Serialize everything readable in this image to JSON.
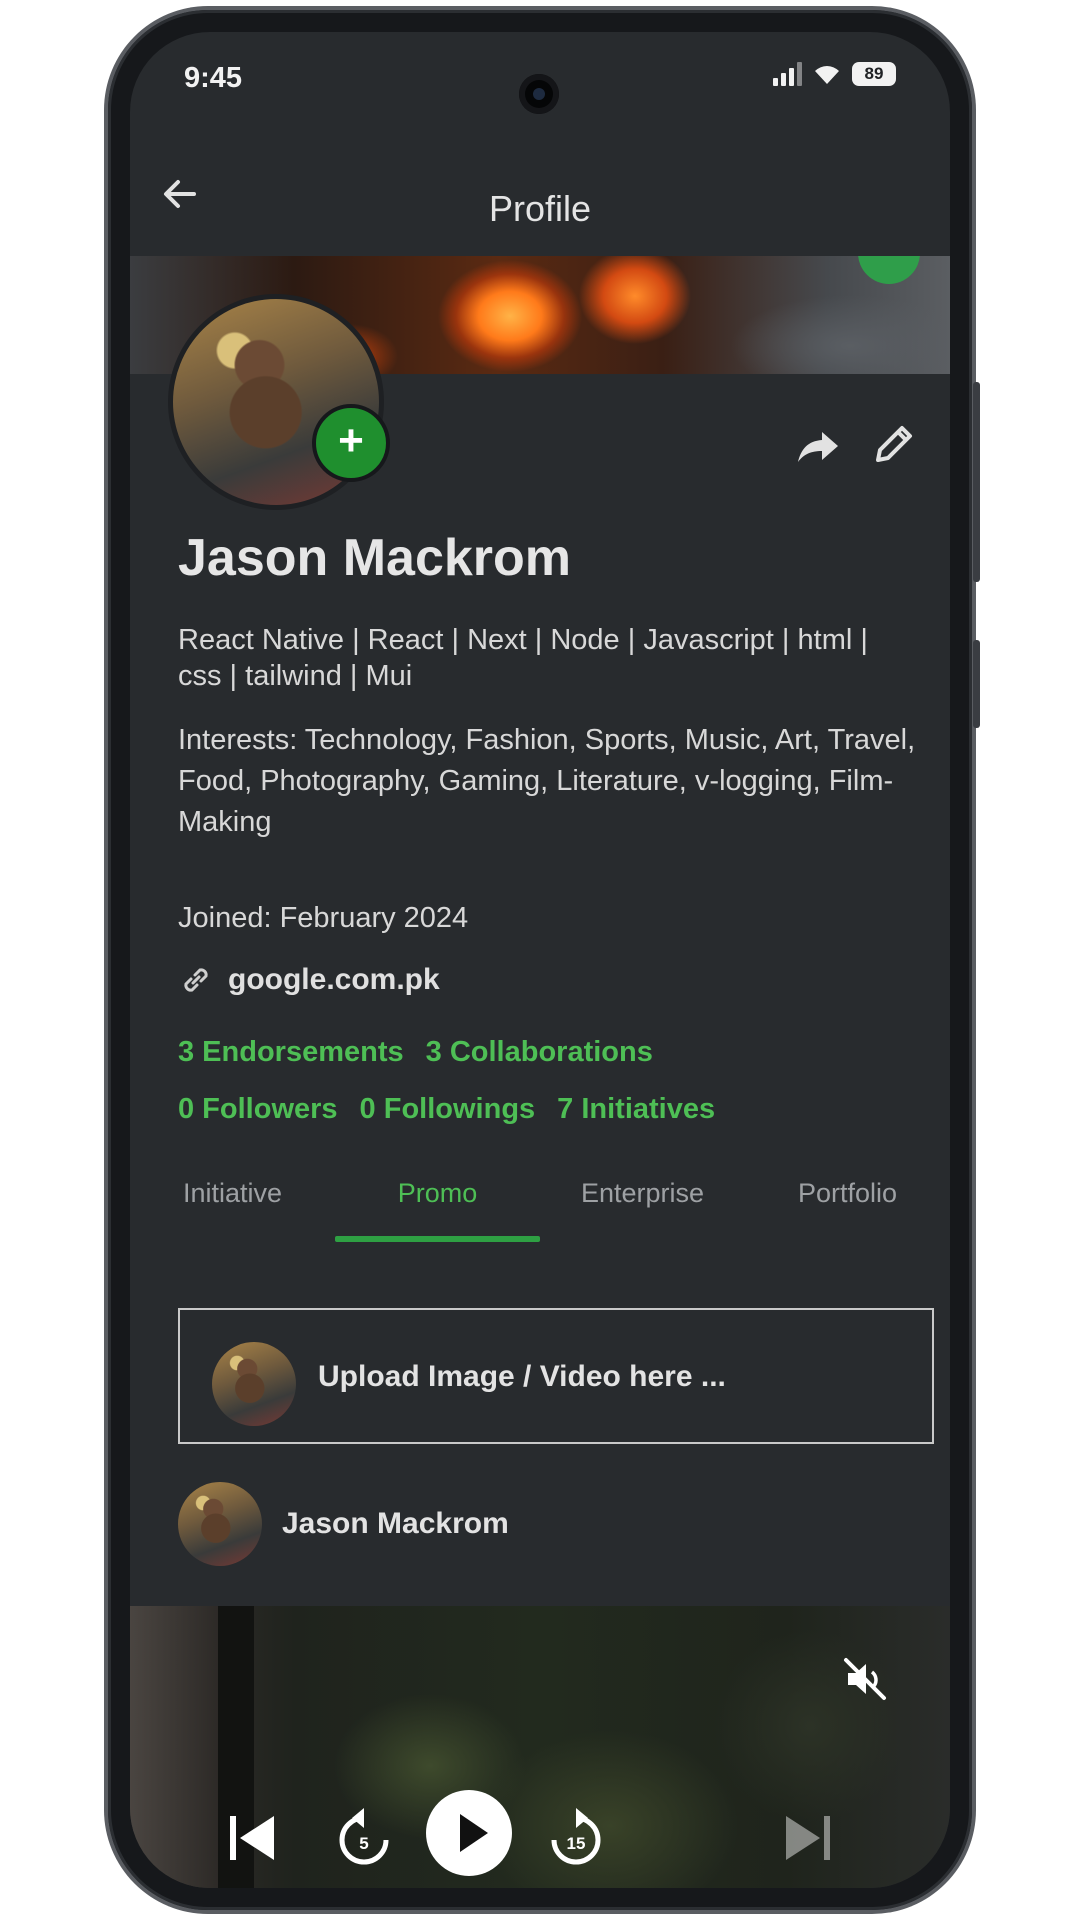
{
  "status_bar": {
    "time": "9:45",
    "battery": "89"
  },
  "app_bar": {
    "title": "Profile"
  },
  "profile": {
    "name": "Jason Mackrom",
    "bio": "React Native | React | Next | Node | Javascript | html | css | tailwind | Mui",
    "interests": "Interests: Technology, Fashion, Sports, Music, Art, Travel, Food, Photography, Gaming, Literature, v-logging, Film-Making",
    "joined": "Joined: February 2024",
    "website": "google.com.pk"
  },
  "stats": {
    "endorsements": "3 Endorsements",
    "collaborations": "3 Collaborations",
    "followers": "0 Followers",
    "followings": "0 Followings",
    "initiatives": "7 Initiatives"
  },
  "tabs": [
    {
      "label": "Initiative",
      "active": false
    },
    {
      "label": "Promo",
      "active": true
    },
    {
      "label": "Enterprise",
      "active": false
    },
    {
      "label": "Portfolio",
      "active": false
    }
  ],
  "upload": {
    "placeholder": "Upload Image / Video here ..."
  },
  "post": {
    "author": "Jason Mackrom"
  },
  "video_controls": {
    "rewind_seconds": "5",
    "forward_seconds": "15"
  },
  "icons": [
    "back-arrow-icon",
    "share-icon",
    "edit-pencil-icon",
    "add-icon",
    "link-icon",
    "mute-icon",
    "skip-previous-icon",
    "replay-5-icon",
    "play-icon",
    "forward-15-icon",
    "skip-next-icon",
    "signal-icon",
    "wifi-icon",
    "battery-icon"
  ],
  "colors": {
    "accent_green": "#4ebf55",
    "background": "#282b2e",
    "add_button": "#1f8f2e"
  }
}
